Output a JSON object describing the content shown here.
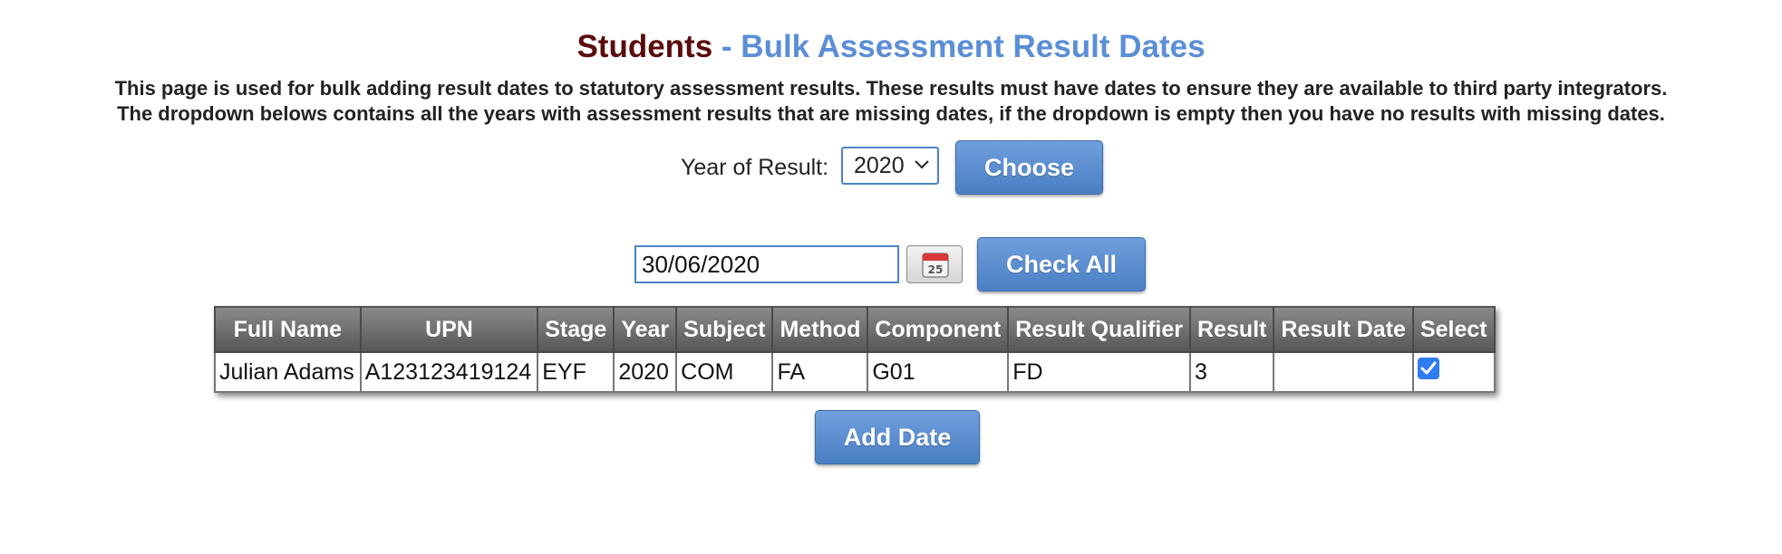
{
  "header": {
    "title_main": "Students",
    "title_sep": " - ",
    "title_sub": "Bulk Assessment Result Dates",
    "desc_line1": "This page is used for bulk adding result dates to statutory assessment results. These results must have dates to ensure they are available to third party integrators.",
    "desc_line2": "The dropdown belows contains all the years with assessment results that are missing dates, if the dropdown is empty then you have no results with missing dates."
  },
  "year_filter": {
    "label": "Year of Result:",
    "selected": "2020",
    "choose_label": "Choose"
  },
  "date_entry": {
    "value": "30/06/2020",
    "calendar_day": "25",
    "check_all_label": "Check All"
  },
  "table": {
    "columns": [
      "Full Name",
      "UPN",
      "Stage",
      "Year",
      "Subject",
      "Method",
      "Component",
      "Result Qualifier",
      "Result",
      "Result Date",
      "Select"
    ],
    "rows": [
      {
        "full_name": "Julian Adams",
        "upn": "A123123419124",
        "stage": "EYF",
        "year": "2020",
        "subject": "COM",
        "method": "FA",
        "component": "G01",
        "result_qualifier": "FD",
        "result": "3",
        "result_date": "",
        "selected": true
      }
    ]
  },
  "actions": {
    "add_date_label": "Add Date"
  },
  "colors": {
    "title_main": "#5a0c0c",
    "title_sub": "#5b8ed6",
    "button_blue": "#4a7fc4",
    "header_gray": "#6b6b6b",
    "checkbox_blue": "#2f7bf0"
  }
}
